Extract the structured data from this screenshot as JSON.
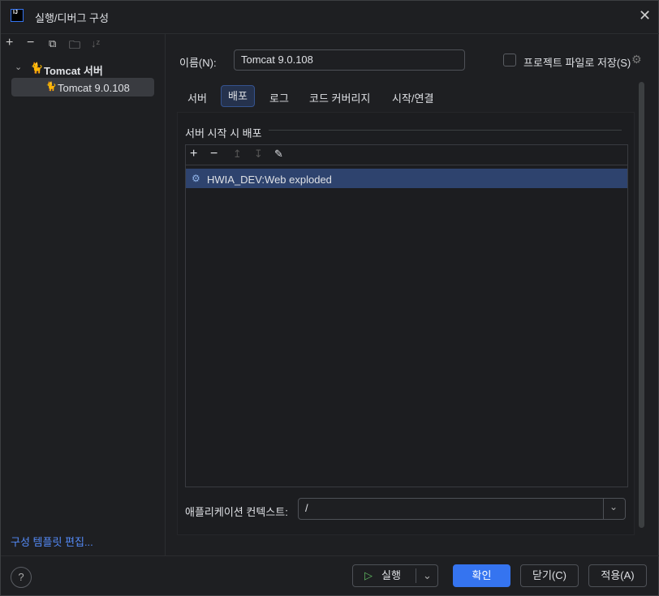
{
  "window": {
    "title": "실행/디버그 구성",
    "logo": "IJ"
  },
  "sidebar": {
    "toolbar": [
      "add-icon",
      "remove-icon",
      "copy-icon",
      "new-folder-icon",
      "sort-icon"
    ],
    "tree": {
      "group": "Tomcat 서버",
      "items": [
        {
          "label": "Tomcat 9.0.108",
          "selected": true
        }
      ]
    },
    "template_link": "구성 템플릿 편집..."
  },
  "main": {
    "name_label": "이름(N):",
    "name_value": "Tomcat 9.0.108",
    "store_label": "프로젝트 파일로 저장(S)",
    "store_checked": false,
    "tabs": [
      {
        "label": "서버"
      },
      {
        "label": "배포",
        "active": true
      },
      {
        "label": "로그"
      },
      {
        "label": "코드 커버리지"
      },
      {
        "label": "시작/연결"
      }
    ],
    "section_title": "서버 시작 시 배포",
    "deploy_items": [
      {
        "label": "HWIA_DEV:Web exploded",
        "selected": true
      }
    ],
    "context_label": "애플리케이션 컨텍스트:",
    "context_value": "/"
  },
  "footer": {
    "run": "실행",
    "ok": "확인",
    "close": "닫기(C)",
    "apply": "적용(A)",
    "help": "?"
  },
  "colors": {
    "accent": "#3574f0",
    "selection": "#2e436e",
    "link": "#548af7"
  }
}
